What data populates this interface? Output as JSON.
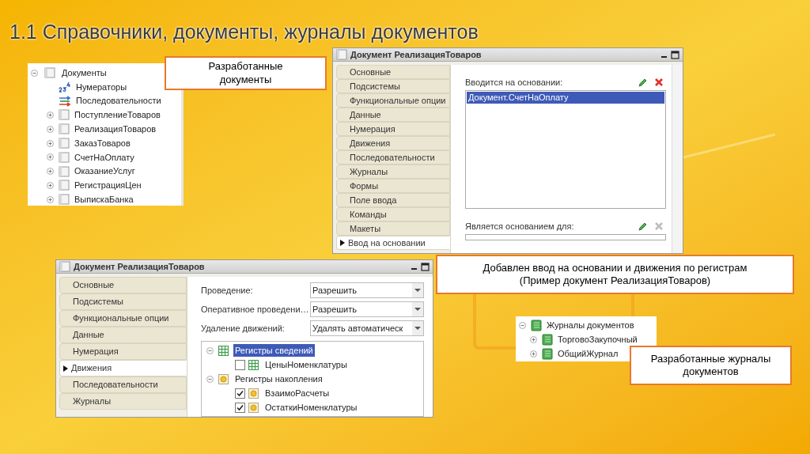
{
  "title": "1.1 Справочники, документы, журналы документов",
  "documents_tree": {
    "label": "Документы",
    "expanded": true,
    "children": [
      {
        "label": "Нумераторы",
        "kind": "numerators"
      },
      {
        "label": "Последовательности",
        "kind": "sequences"
      },
      {
        "label": "ПоступлениеТоваров",
        "kind": "document",
        "expanded": false
      },
      {
        "label": "РеализацияТоваров",
        "kind": "document",
        "expanded": false
      },
      {
        "label": "ЗаказТоваров",
        "kind": "document",
        "expanded": false
      },
      {
        "label": "СчетНаОплату",
        "kind": "document",
        "expanded": false
      },
      {
        "label": "ОказаниеУслуг",
        "kind": "document",
        "expanded": false
      },
      {
        "label": "РегистрацияЦен",
        "kind": "document",
        "expanded": false
      },
      {
        "label": "ВыпискаБанка",
        "kind": "document",
        "expanded": false
      }
    ]
  },
  "journals_tree": {
    "label": "Журналы документов",
    "expanded": true,
    "children": [
      {
        "label": "ТорговоЗакупочный",
        "expanded": false
      },
      {
        "label": "ОбщийЖурнал",
        "expanded": false
      }
    ]
  },
  "callouts": [
    {
      "text": "Разработанные документы"
    },
    {
      "text": "Добавлен ввод на основании и движения по регистрам (Пример документ РеализацияТоваров)"
    },
    {
      "text": "Разработанные журналы документов"
    }
  ],
  "window_basis": {
    "title": "Документ РеализацияТоваров",
    "tabs": [
      {
        "label": "Основные",
        "selected": false
      },
      {
        "label": "Подсистемы",
        "selected": false
      },
      {
        "label": "Функциональные опции",
        "selected": false
      },
      {
        "label": "Данные",
        "selected": false
      },
      {
        "label": "Нумерация",
        "selected": false
      },
      {
        "label": "Движения",
        "selected": false
      },
      {
        "label": "Последовательности",
        "selected": false
      },
      {
        "label": "Журналы",
        "selected": false
      },
      {
        "label": "Формы",
        "selected": false
      },
      {
        "label": "Поле ввода",
        "selected": false
      },
      {
        "label": "Команды",
        "selected": false
      },
      {
        "label": "Макеты",
        "selected": false
      },
      {
        "label": "Ввод на основании",
        "selected": true
      }
    ],
    "lists": [
      {
        "label": "Вводится на основании:",
        "delete_enabled": true,
        "items": [
          {
            "label": "Документ.СчетНаОплату",
            "selected": true
          }
        ]
      },
      {
        "label": "Является основанием для:",
        "delete_enabled": false
      }
    ]
  },
  "window_movements": {
    "title": "Документ РеализацияТоваров",
    "tabs": [
      {
        "label": "Основные",
        "selected": false
      },
      {
        "label": "Подсистемы",
        "selected": false
      },
      {
        "label": "Функциональные опции",
        "selected": false
      },
      {
        "label": "Данные",
        "selected": false
      },
      {
        "label": "Нумерация",
        "selected": false
      },
      {
        "label": "Движения",
        "selected": true
      },
      {
        "label": "Последовательности",
        "selected": false
      },
      {
        "label": "Журналы",
        "selected": false
      }
    ],
    "fields": [
      {
        "label": "Проведение:",
        "value": "Разрешить"
      },
      {
        "label": "Оперативное проведени…",
        "value": "Разрешить"
      },
      {
        "label": "Удаление движений:",
        "value": "Удалять автоматическ"
      }
    ],
    "registers": [
      {
        "label": "Регистры сведений",
        "kind": "info",
        "expanded": true,
        "selected": true,
        "children": [
          {
            "label": "ЦеныНоменклатуры",
            "checked": false
          }
        ]
      },
      {
        "label": "Регистры накопления",
        "kind": "accumulation",
        "expanded": true,
        "selected": false,
        "children": [
          {
            "label": "ВзаимоРасчеты",
            "checked": true
          },
          {
            "label": "ОстаткиНоменклатуры",
            "checked": true
          }
        ]
      }
    ]
  }
}
